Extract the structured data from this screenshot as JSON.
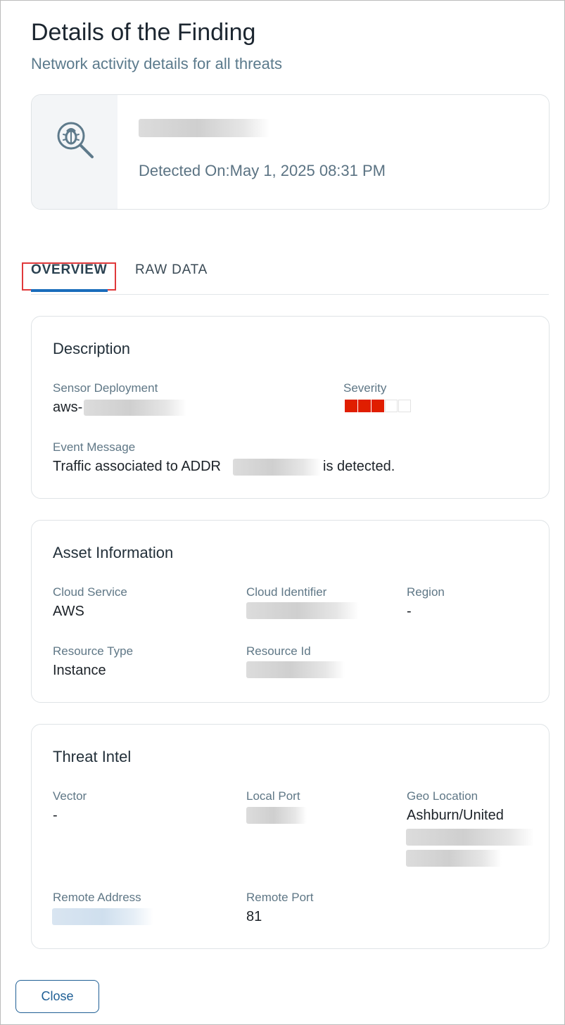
{
  "header": {
    "title": "Details of the Finding",
    "subtitle": "Network activity details for all threats"
  },
  "finding": {
    "icon": "bug-search-icon",
    "detected_label": "Detected On:",
    "detected_value": "May 1, 2025 08:31 PM"
  },
  "tabs": [
    {
      "label": "OVERVIEW",
      "active": true
    },
    {
      "label": "RAW DATA",
      "active": false
    }
  ],
  "description": {
    "title": "Description",
    "sensor_deployment_label": "Sensor Deployment",
    "sensor_deployment_value": "aws-",
    "severity_label": "Severity",
    "severity_level": 3,
    "severity_max": 5,
    "event_message_label": "Event Message",
    "event_message_prefix": "Traffic associated to ADDR",
    "event_message_suffix": "is detected."
  },
  "asset": {
    "title": "Asset Information",
    "cloud_service_label": "Cloud Service",
    "cloud_service_value": "AWS",
    "cloud_identifier_label": "Cloud Identifier",
    "region_label": "Region",
    "region_value": "-",
    "resource_type_label": "Resource Type",
    "resource_type_value": "Instance",
    "resource_id_label": "Resource Id"
  },
  "threat_intel": {
    "title": "Threat Intel",
    "vector_label": "Vector",
    "vector_value": "-",
    "local_port_label": "Local Port",
    "geo_location_label": "Geo Location",
    "geo_location_value": "Ashburn/United",
    "remote_address_label": "Remote Address",
    "remote_port_label": "Remote Port",
    "remote_port_value": "81"
  },
  "footer": {
    "close_label": "Close"
  },
  "colors": {
    "accent": "#1a6dbb",
    "severity_on": "#e01e00",
    "tab_highlight": "#e0393b"
  }
}
